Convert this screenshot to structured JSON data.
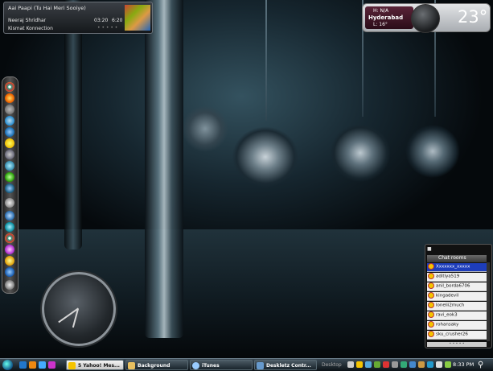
{
  "player": {
    "song": "Aai Paapi (Tu Hai Meri Sooiye)",
    "artist": "Neeraj Shridhar",
    "album": "Kismat Konnection",
    "elapsed": "03:20",
    "duration": "6:20",
    "rating": "• • • • •"
  },
  "weather": {
    "hilo": "H: N/A",
    "city": "Hyderabad",
    "low": "L: 16°",
    "temp": "23°"
  },
  "chat": {
    "header": "■",
    "title": "Chat rooms",
    "rooms": [
      "Xxxxxxx_xxxxx",
      "aditiya519",
      "anil_borda6706",
      "kingadevil",
      "lonelii2much",
      "ravi_eok3",
      "rohansaky",
      "sku_crusher26"
    ],
    "footer": "• • • • •"
  },
  "taskbar": {
    "tasks": [
      {
        "label": "5 Yahoo! Mes..."
      },
      {
        "label": "Background"
      },
      {
        "label": "iTunes"
      },
      {
        "label": "Deskletz Contr..."
      },
      {
        "label": "Desktop"
      }
    ],
    "time": "8:33 PM"
  },
  "colors": {
    "selected_row": "#1d3dbb",
    "taskbar": "#0c1318"
  }
}
